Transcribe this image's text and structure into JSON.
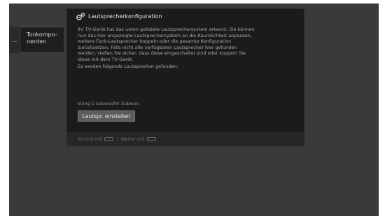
{
  "menu": {
    "prev_label": "...",
    "item_line1": "Tonkompo-",
    "item_line2": "nenten"
  },
  "dialog": {
    "icon": "speaker-config-icon",
    "title": "Lautsprecherkonfiguration",
    "body_lines": [
      "Ihr TV-Gerät hat das unten gelistete Lautsprechersystem erkannt. Sie können",
      "nun das hier angezeigte Lautsprechersystem an die Räumlichkeit anpassen,",
      "weitere Funk-Lautsprecher koppeln oder die gesamte Konfiguration",
      "zurücksetzen. Falls nicht alle verfügbaren Lautsprecher hier gefunden",
      "werden, stellen Sie sicher, dass diese eingeschaltet sind oder koppeln Sie",
      "diese mit dem TV-Gerät."
    ],
    "found_label": "Es werden folgende Lautsprecher gefunden:",
    "speaker_system": "klang 5 subwoofer Subwoo",
    "config_button_label": "Lautspr. einstellen"
  },
  "footer": {
    "back_label": "Zurück mit",
    "separator": "|",
    "next_label": "Weiter mit"
  }
}
